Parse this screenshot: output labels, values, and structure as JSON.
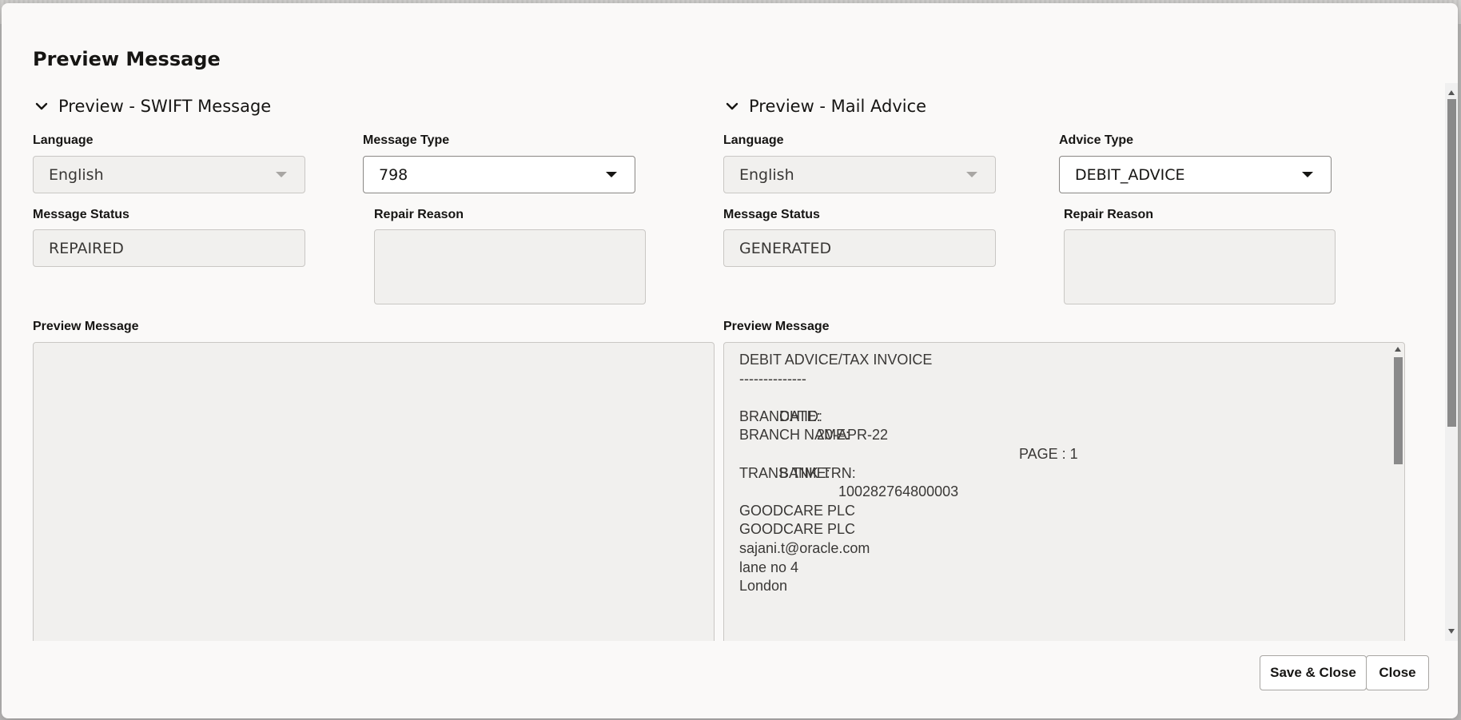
{
  "dialog": {
    "title": "Preview Message"
  },
  "swift": {
    "section_title": "Preview - SWIFT Message",
    "language_label": "Language",
    "language_value": "English",
    "message_type_label": "Message Type",
    "message_type_value": "798",
    "message_status_label": "Message Status",
    "message_status_value": "REPAIRED",
    "repair_reason_label": "Repair Reason",
    "preview_label": "Preview Message"
  },
  "mail": {
    "section_title": "Preview - Mail Advice",
    "language_label": "Language",
    "language_value": "English",
    "advice_type_label": "Advice Type",
    "advice_type_value": "DEBIT_ADVICE",
    "message_status_label": "Message Status",
    "message_status_value": "GENERATED",
    "repair_reason_label": "Repair Reason",
    "preview_label": "Preview Message",
    "preview_lines": {
      "heading": "DEBIT ADVICE/TAX INVOICE",
      "rule": "--------------",
      "date_label": "DATE:",
      "date_value": "20-APR-22",
      "page_label": "PAGE : 1",
      "branch_id_label": "BRANCH ID:",
      "branch_name_label": "BRANCH NAME:",
      "bank_trn_label": "BANK TRN:",
      "bank_trn_value": "100282764800003",
      "trans_time_label": "TRANS TIME:",
      "customer_name_1": "GOODCARE PLC",
      "customer_name_2": "GOODCARE PLC",
      "email": "sajani.t@oracle.com",
      "address_1": "lane no 4",
      "address_2": "London"
    }
  },
  "footer": {
    "save_close_label": "Save & Close",
    "close_label": "Close"
  },
  "icons": {
    "chevron": "chevron-down-icon",
    "caret": "caret-down-icon"
  }
}
